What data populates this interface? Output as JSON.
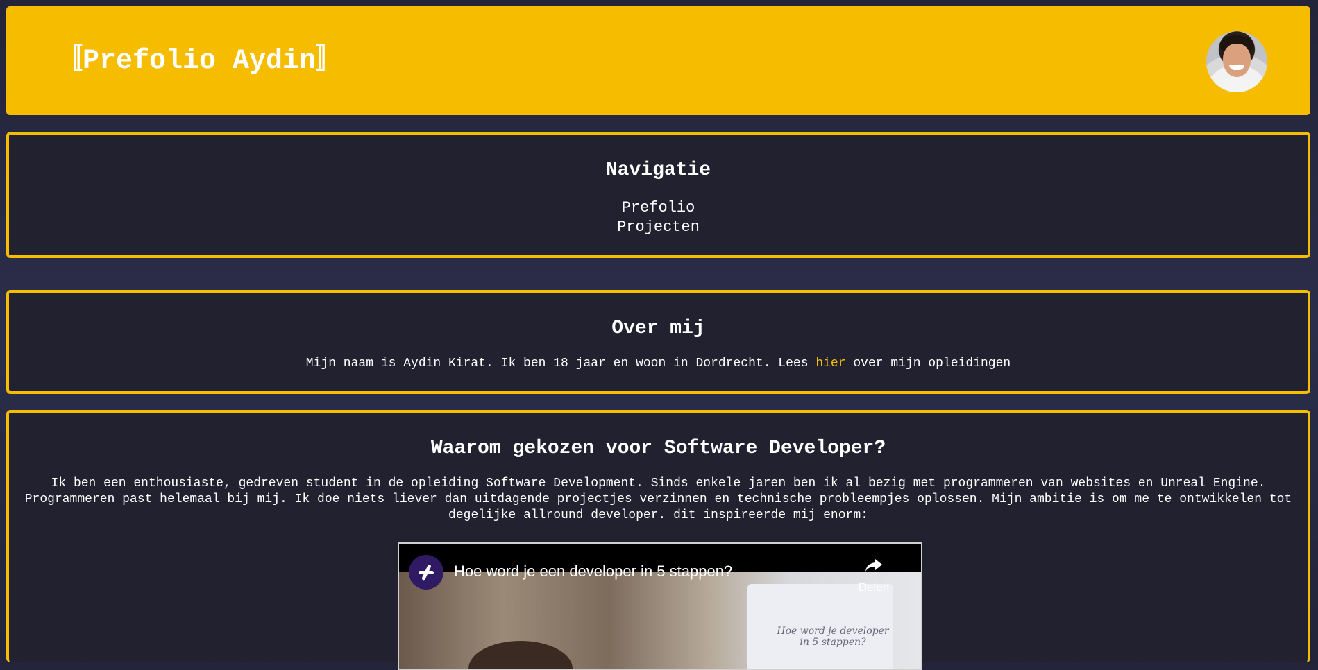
{
  "header": {
    "title": "〚Prefolio Aydin〛",
    "avatar_alt": "avatar"
  },
  "navigation": {
    "heading": "Navigatie",
    "items": [
      "Prefolio",
      "Projecten"
    ]
  },
  "about": {
    "heading": "Over mij",
    "text_before": "Mijn naam is Aydin Kirat. Ik ben 18 jaar en woon in Dordrecht. Lees ",
    "link_text": "hier",
    "text_after": " over mijn opleidingen"
  },
  "why": {
    "heading": "Waarom gekozen voor Software Developer?",
    "text": "Ik ben een enthousiaste, gedreven student in de opleiding Software Development. Sinds enkele jaren ben ik al bezig met programmeren van websites en Unreal Engine. Programmeren past helemaal bij mij. Ik doe niets liever dan uitdagende projectjes verzinnen en technische probleempjes oplossen. Mijn ambitie is om me te ontwikkelen tot degelijke allround developer. dit inspireerde mij enorm:",
    "video": {
      "title": "Hoe word je een developer in 5 stappen?",
      "share_label": "Delen",
      "board_text": "Hoe word je developer in 5 stappen?"
    }
  },
  "colors": {
    "accent": "#f5bc00",
    "panel_bg": "#212130",
    "page_bg": "#2b2e4a"
  }
}
